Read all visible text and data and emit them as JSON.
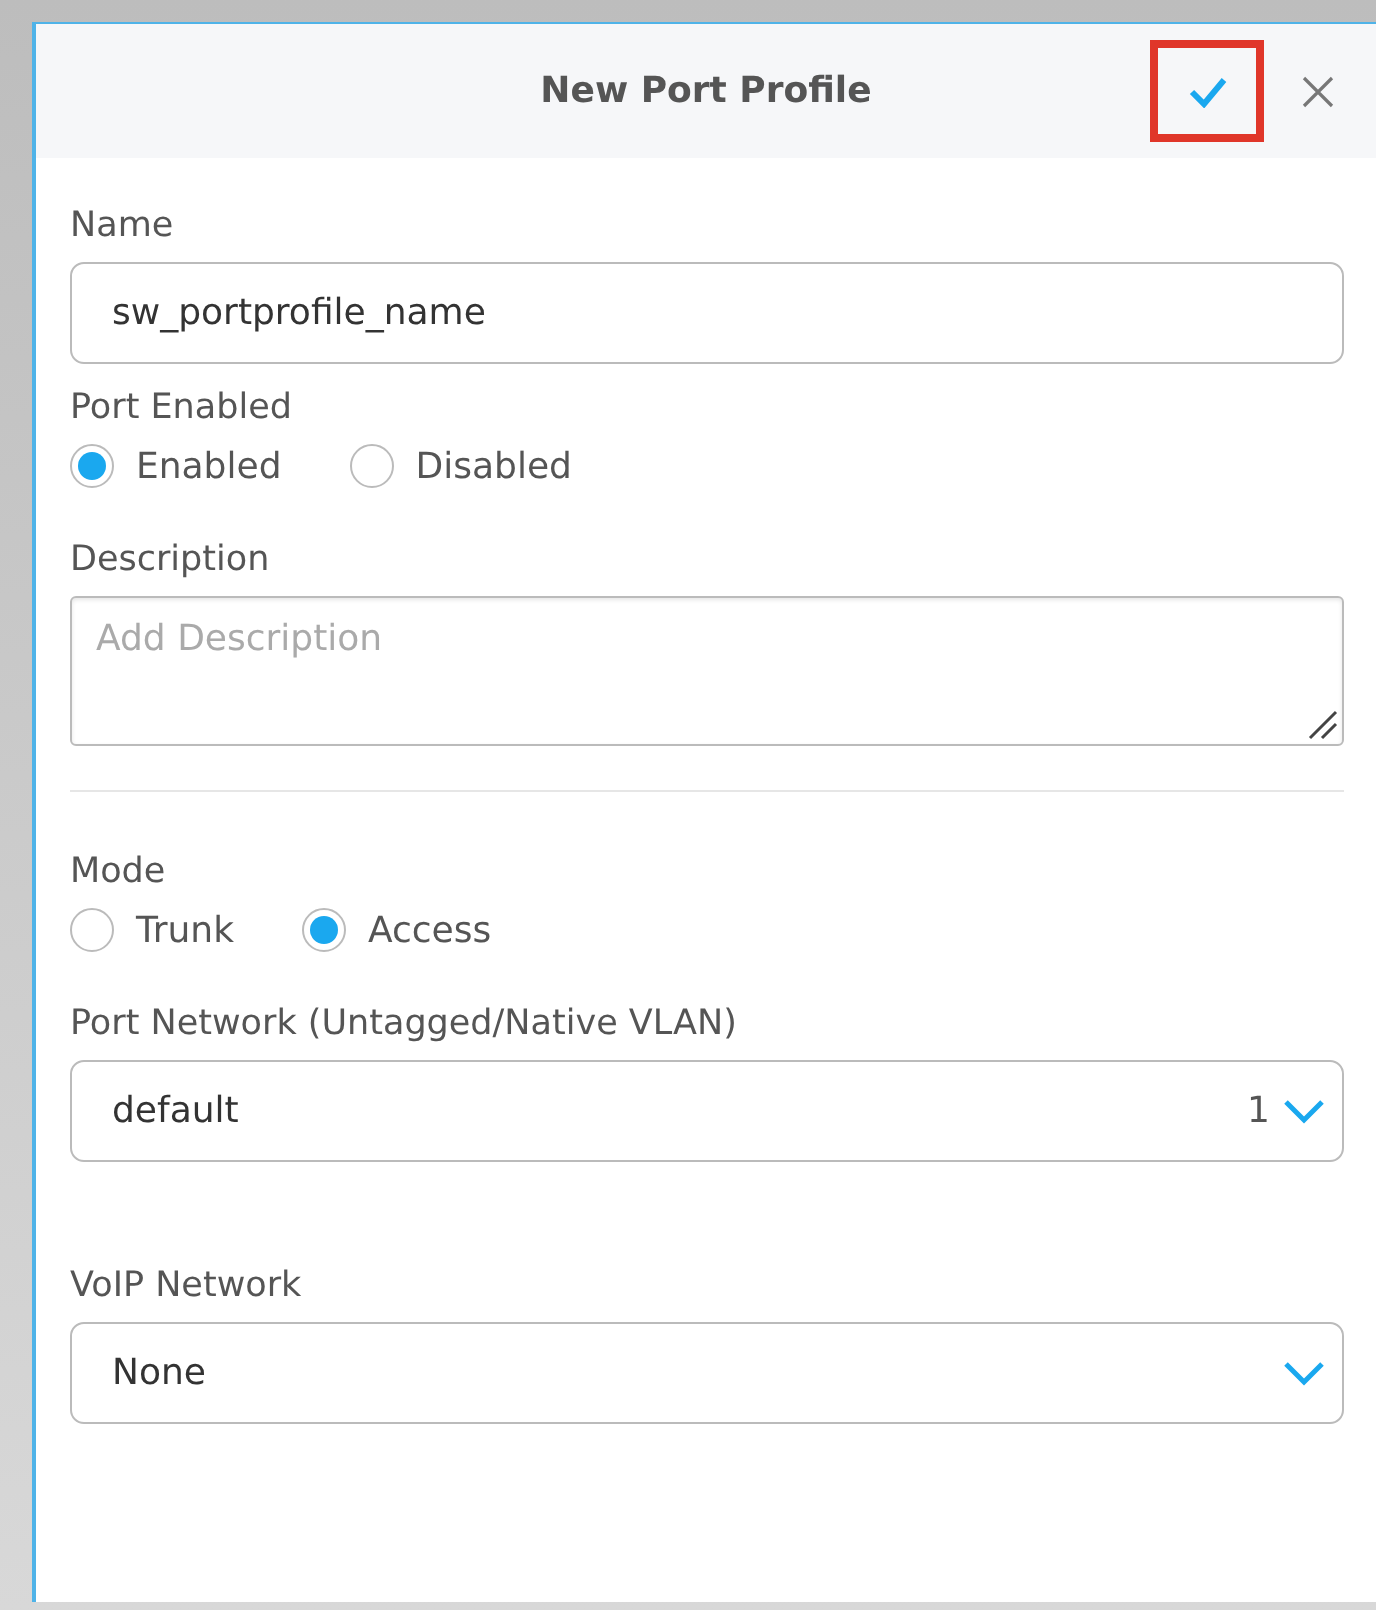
{
  "panel": {
    "title": "New Port Profile",
    "confirm_highlighted": true
  },
  "fields": [
    {
      "kind": "text",
      "label": "Name",
      "value": "sw_portprofile_name"
    },
    {
      "kind": "radio",
      "label": "Port Enabled",
      "options": [
        {
          "label": "Enabled",
          "selected": true
        },
        {
          "label": "Disabled",
          "selected": false
        }
      ]
    },
    {
      "kind": "textarea",
      "label": "Description",
      "placeholder": "Add Description"
    },
    {
      "kind": "divider"
    },
    {
      "kind": "radio",
      "label": "Mode",
      "options": [
        {
          "label": "Trunk",
          "selected": false
        },
        {
          "label": "Access",
          "selected": true
        }
      ]
    },
    {
      "kind": "select",
      "label": "Port Network (Untagged/Native VLAN)",
      "value": "default",
      "suffix": "1"
    },
    {
      "kind": "select",
      "label": "VoIP Network",
      "value": "None"
    }
  ]
}
